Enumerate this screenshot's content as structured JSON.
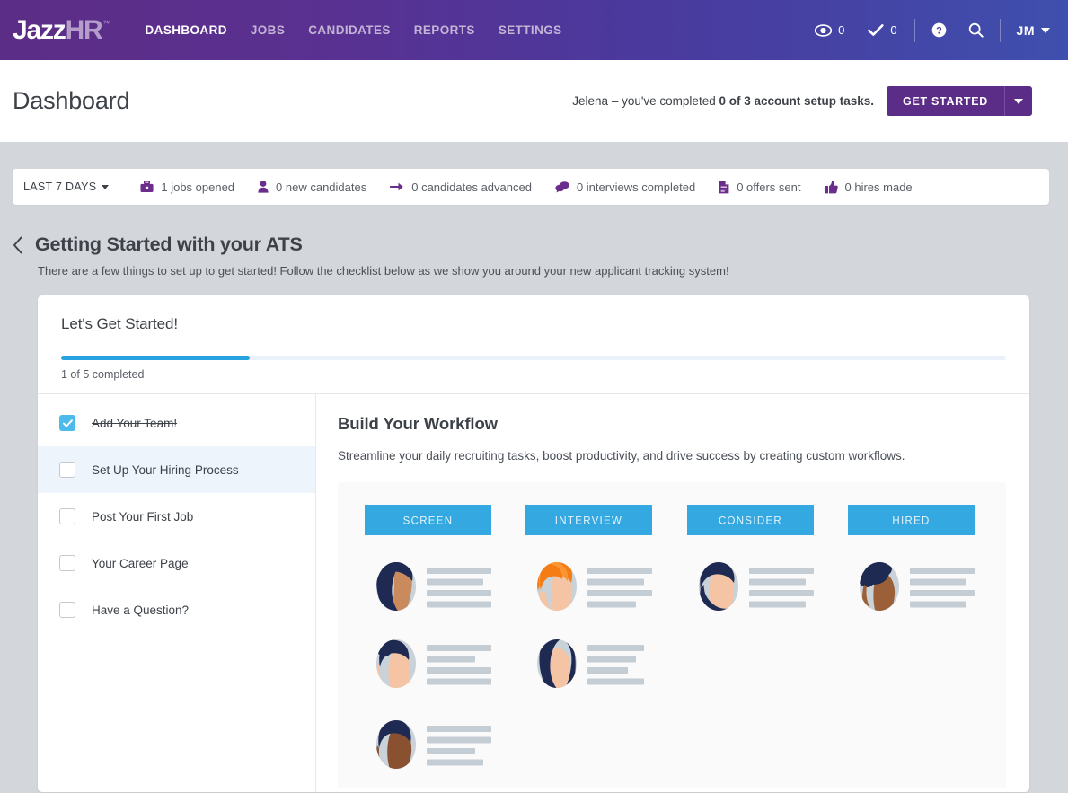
{
  "brand": {
    "logo_jazz": "Jazz",
    "logo_hr": "HR",
    "logo_tm": "™",
    "accent_purple": "#5c2d86",
    "accent_blue": "#29a3e0",
    "header_gradient_from": "#5c2d86",
    "header_gradient_to": "#3f4fad"
  },
  "topnav": {
    "links": [
      {
        "label": "DASHBOARD",
        "active": true
      },
      {
        "label": "JOBS",
        "active": false
      },
      {
        "label": "CANDIDATES",
        "active": false
      },
      {
        "label": "REPORTS",
        "active": false
      },
      {
        "label": "SETTINGS",
        "active": false
      }
    ],
    "watch_icon": "eye-icon",
    "watch_count": "0",
    "tasks_icon": "check-icon",
    "tasks_count": "0",
    "help_icon": "help-circle-icon",
    "search_icon": "search-icon",
    "user_initials": "JM",
    "user_caret": "chevron-down-icon"
  },
  "titlebar": {
    "title": "Dashboard",
    "setup_prefix": "Jelena – you've completed ",
    "setup_bold": "0 of 3 account setup tasks.",
    "get_started_label": "GET STARTED",
    "split_caret": "chevron-down-icon"
  },
  "statsbar": {
    "range_label": "LAST 7 DAYS",
    "range_caret": "chevron-down-icon",
    "items": [
      {
        "icon": "briefcase-icon",
        "label": "1 jobs opened"
      },
      {
        "icon": "person-icon",
        "label": "0 new candidates"
      },
      {
        "icon": "arrow-right-icon",
        "label": "0 candidates advanced"
      },
      {
        "icon": "chat-bubble-icon",
        "label": "0 interviews completed"
      },
      {
        "icon": "document-icon",
        "label": "0 offers sent"
      },
      {
        "icon": "thumbs-up-icon",
        "label": "0 hires made"
      }
    ]
  },
  "getting_started": {
    "back_icon": "chevron-left-icon",
    "title": "Getting Started with your ATS",
    "subtitle": "There are a few things to set up to get started! Follow the checklist below as we show you around your new applicant tracking system!"
  },
  "card": {
    "title": "Let's Get Started!",
    "progress_percent": 20,
    "progress_label": "1 of 5 completed",
    "checklist": [
      {
        "label": "Add Your Team!",
        "done": true,
        "selected": false
      },
      {
        "label": "Set Up Your Hiring Process",
        "done": false,
        "selected": true
      },
      {
        "label": "Post Your First Job",
        "done": false,
        "selected": false
      },
      {
        "label": "Your Career Page",
        "done": false,
        "selected": false
      },
      {
        "label": "Have a Question?",
        "done": false,
        "selected": false
      }
    ],
    "content": {
      "title": "Build Your Workflow",
      "description": "Streamline your daily recruiting tasks, boost productivity, and drive success by creating custom workflows.",
      "illustration": {
        "name": "workflow-pipeline-illustration",
        "background": "#fafafa",
        "stage_color": "#34a8e0",
        "stages": [
          {
            "label": "SCREEN",
            "candidates": 3
          },
          {
            "label": "INTERVIEW",
            "candidates": 2
          },
          {
            "label": "CONSIDER",
            "candidates": 1
          },
          {
            "label": "HIRED",
            "candidates": 1
          }
        ]
      }
    }
  }
}
